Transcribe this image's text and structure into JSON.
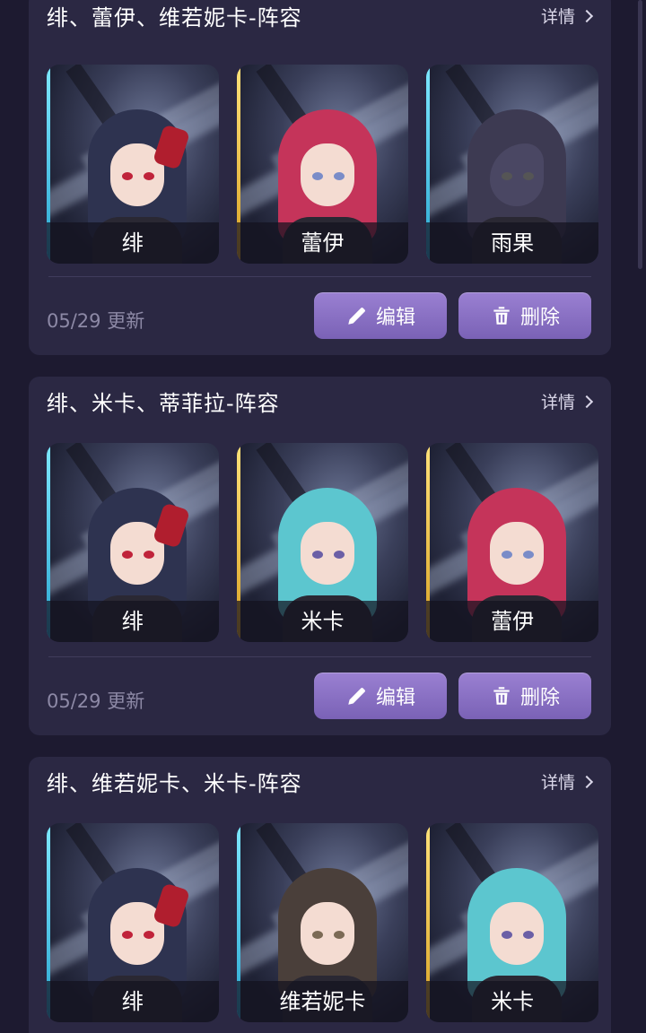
{
  "detail_label": "详情",
  "edit_label": "编辑",
  "delete_label": "删除",
  "cards": [
    {
      "title": "绯、蕾伊、维若妮卡-阵容",
      "updated": "05/29 更新",
      "members": [
        {
          "name": "绯",
          "edge": "cyan",
          "hair": "#2e3350",
          "eye": "#c0233a",
          "mask": true
        },
        {
          "name": "蕾伊",
          "edge": "gold",
          "hair": "#c5345a",
          "eye": "#7a8cc8"
        },
        {
          "name": "雨果",
          "edge": "cyan",
          "hair": "#3d3a52",
          "eye": "#555",
          "wolf": true
        }
      ]
    },
    {
      "title": "绯、米卡、蒂菲拉-阵容",
      "updated": "05/29 更新",
      "members": [
        {
          "name": "绯",
          "edge": "cyan",
          "hair": "#2e3350",
          "eye": "#c0233a",
          "mask": true
        },
        {
          "name": "米卡",
          "edge": "gold",
          "hair": "#5cc6cf",
          "eye": "#6b5fa6"
        },
        {
          "name": "蕾伊",
          "edge": "gold",
          "hair": "#c5345a",
          "eye": "#7a8cc8"
        }
      ]
    },
    {
      "title": "绯、维若妮卡、米卡-阵容",
      "updated": "",
      "members": [
        {
          "name": "绯",
          "edge": "cyan",
          "hair": "#2e3350",
          "eye": "#c0233a",
          "mask": true
        },
        {
          "name": "维若妮卡",
          "edge": "cyan",
          "hair": "#4a3f3a",
          "eye": "#7b6a55"
        },
        {
          "name": "米卡",
          "edge": "gold",
          "hair": "#5cc6cf",
          "eye": "#6b5fa6"
        }
      ]
    }
  ]
}
